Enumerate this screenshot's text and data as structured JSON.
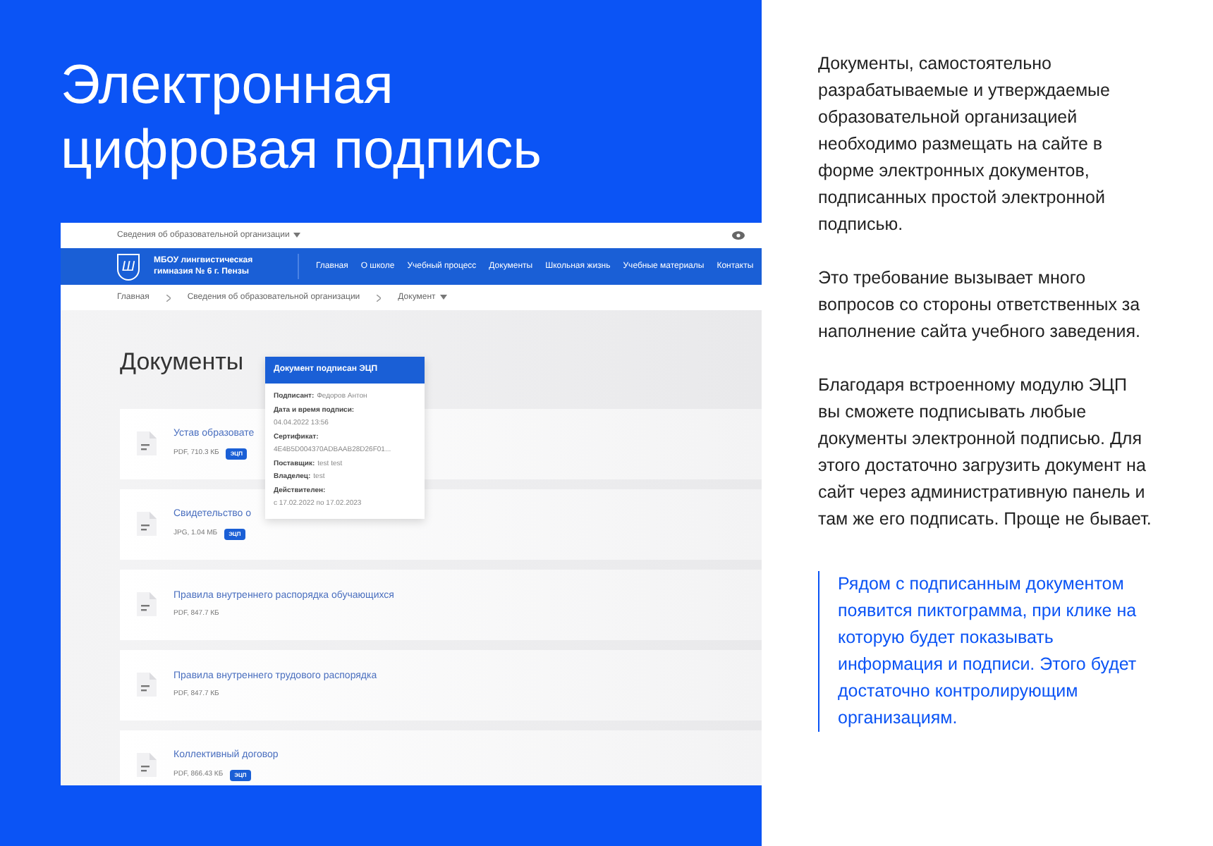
{
  "headline": "Электронная цифровая подпись",
  "site": {
    "top_link": {
      "label": "Сведения об образовательной организации",
      "dropdown": true
    },
    "logo_letter": "Ш",
    "school_name": "МБОУ лингвистическая гимназия № 6 г. Пензы",
    "nav": [
      "Главная",
      "О школе",
      "Учебный процесс",
      "Документы",
      "Школьная жизнь",
      "Учебные материалы",
      "Контакты"
    ],
    "breadcrumbs": [
      {
        "label": "Главная",
        "dropdown": false
      },
      {
        "label": "Сведения об образовательной организации",
        "dropdown": false
      },
      {
        "label": "Документ",
        "dropdown": true
      }
    ],
    "page_title": "Документы",
    "documents": [
      {
        "title": "Устав образовате",
        "meta": "PDF, 710.3 КБ",
        "badge": "ЭЦП"
      },
      {
        "title": "Свидетельство о",
        "meta": "JPG, 1.04 МБ",
        "badge": "ЭЦП"
      },
      {
        "title": "Правила внутреннего распорядка обучающихся",
        "meta": "PDF, 847.7 КБ"
      },
      {
        "title": "Правила внутреннего трудового распорядка",
        "meta": "PDF, 847.7 КБ"
      },
      {
        "title": "Коллективный договор",
        "meta": "PDF, 866.43 КБ",
        "badge": "ЭЦП"
      }
    ],
    "popup": {
      "title": "Документ подписан ЭЦП",
      "fields": [
        {
          "kind": "inline",
          "label": "Подписант:",
          "value": "Федоров Антон"
        },
        {
          "kind": "stacked",
          "label": "Дата и время подписи:",
          "value": "04.04.2022 13:56"
        },
        {
          "kind": "stacked",
          "label": "Сертификат:",
          "value": "4E4B5D004370ADBAAB28D26F01..."
        },
        {
          "kind": "inline",
          "label": "Поставщик:",
          "value": "test test"
        },
        {
          "kind": "inline",
          "label": "Владелец:",
          "value": "test"
        },
        {
          "kind": "stacked",
          "label": "Действителен:",
          "value": "с 17.02.2022 по 17.02.2023"
        }
      ]
    }
  },
  "paragraphs": [
    "Документы, самостоятельно разрабатываемые и утверждаемые образовательной организацией необходимо размещать на сайте в форме электронных документов, подписанных простой электронной подписью.",
    "Это требование вызывает много вопросов со стороны ответственных за наполнение сайта учебного заведения.",
    "Благодаря встроенному модулю ЭЦП вы сможете подписывать любые документы электронной подписью. Для этого достаточно загрузить документ на сайт через административную панель и там же его подписать. Проще не бывает."
  ],
  "note": "Рядом с подписанным документом появится пиктограмма, при клике на которую будет показывать информация и подписи. Этого будет достаточно контролирующим организациям."
}
